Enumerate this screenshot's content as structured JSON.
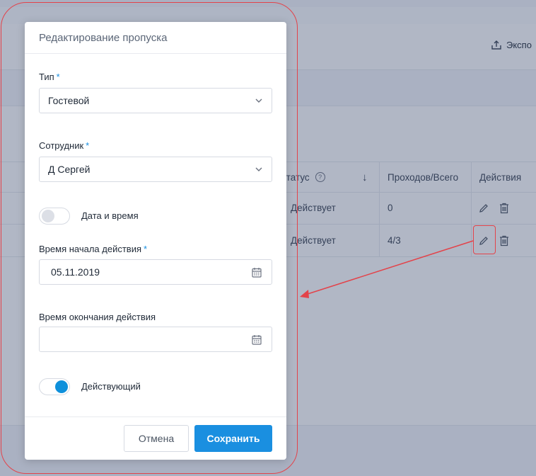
{
  "background": {
    "export_label": "Экспо",
    "table": {
      "headers": {
        "status": "Статус",
        "status_help": "?",
        "sort": "↓",
        "passes": "Проходов/Всего",
        "actions": "Действия"
      },
      "rows": [
        {
          "status": "Действует",
          "passes": "0"
        },
        {
          "status": "Действует",
          "passes": "4/3"
        }
      ]
    }
  },
  "modal": {
    "title": "Редактирование пропуска",
    "type_field": {
      "label": "Тип",
      "required_mark": "*",
      "value": "Гостевой"
    },
    "employee_field": {
      "label": "Сотрудник",
      "required_mark": "*",
      "value": "Д Сергей"
    },
    "datetime_toggle": {
      "label": "Дата и время",
      "state": "off"
    },
    "start_time_field": {
      "label": "Время начала действия",
      "required_mark": "*",
      "value": "05.11.2019"
    },
    "end_time_field": {
      "label": "Время окончания действия",
      "value": ""
    },
    "active_toggle": {
      "label": "Действующий",
      "state": "on"
    },
    "cancel_label": "Отмена",
    "save_label": "Сохранить"
  },
  "colors": {
    "accent": "#1a8fe0",
    "annotation": "#e3434a"
  },
  "icons": [
    "export-icon",
    "help-icon",
    "edit-icon",
    "delete-icon",
    "chevron-down-icon",
    "calendar-icon"
  ]
}
